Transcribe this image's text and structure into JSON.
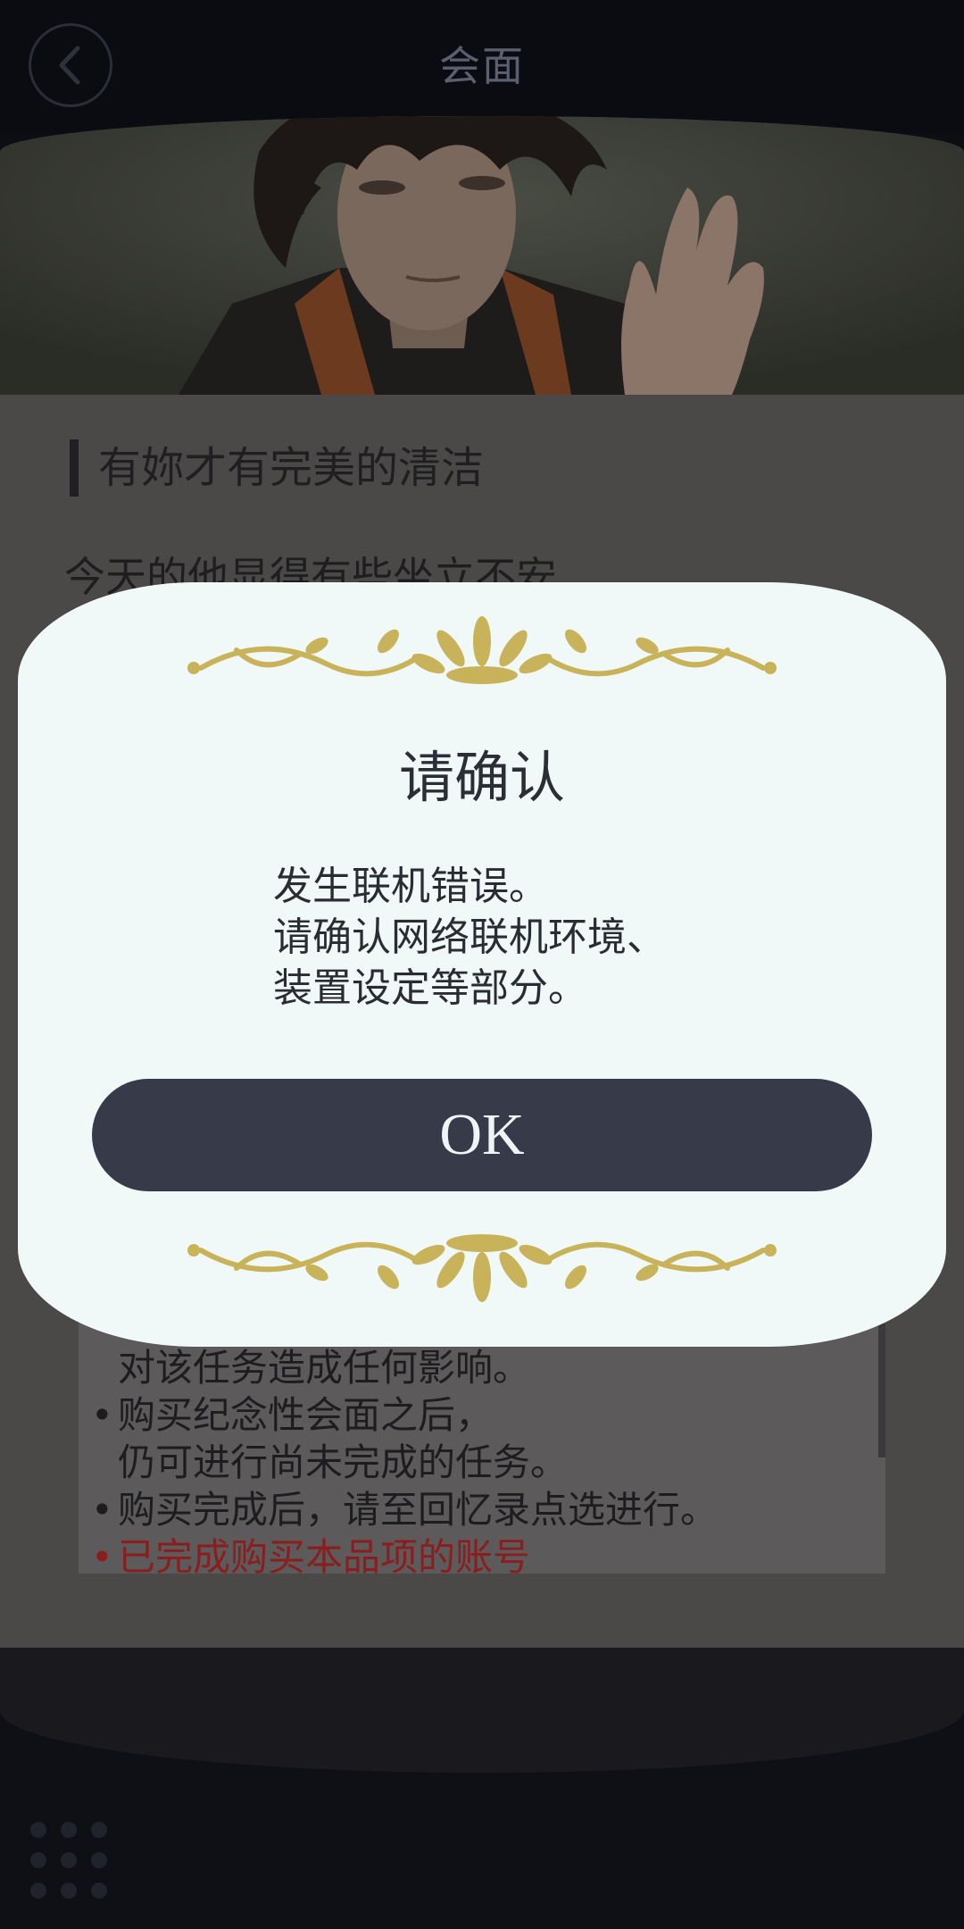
{
  "header": {
    "title": "会面",
    "back_icon": "chevron-left-icon"
  },
  "content": {
    "heading": "有妳才有完美的清洁",
    "intro": "今天的他显得有些坐立不安",
    "notes": [
      "购买纪念性会面将不会\n对该任务造成任何影响。",
      "购买纪念性会面之后，\n仍可进行尚未完成的任务。",
      "购买完成后，请至回忆录点选进行。",
      "已完成购买本品项的账号"
    ]
  },
  "dialog": {
    "title": "请确认",
    "message": "发生联机错误。\n请确认网络联机环境、\n装置设定等部分。",
    "ok_label": "OK",
    "ornament_color": "#c9b35a"
  },
  "bottom": {
    "menu_icon": "grid-menu-icon"
  }
}
